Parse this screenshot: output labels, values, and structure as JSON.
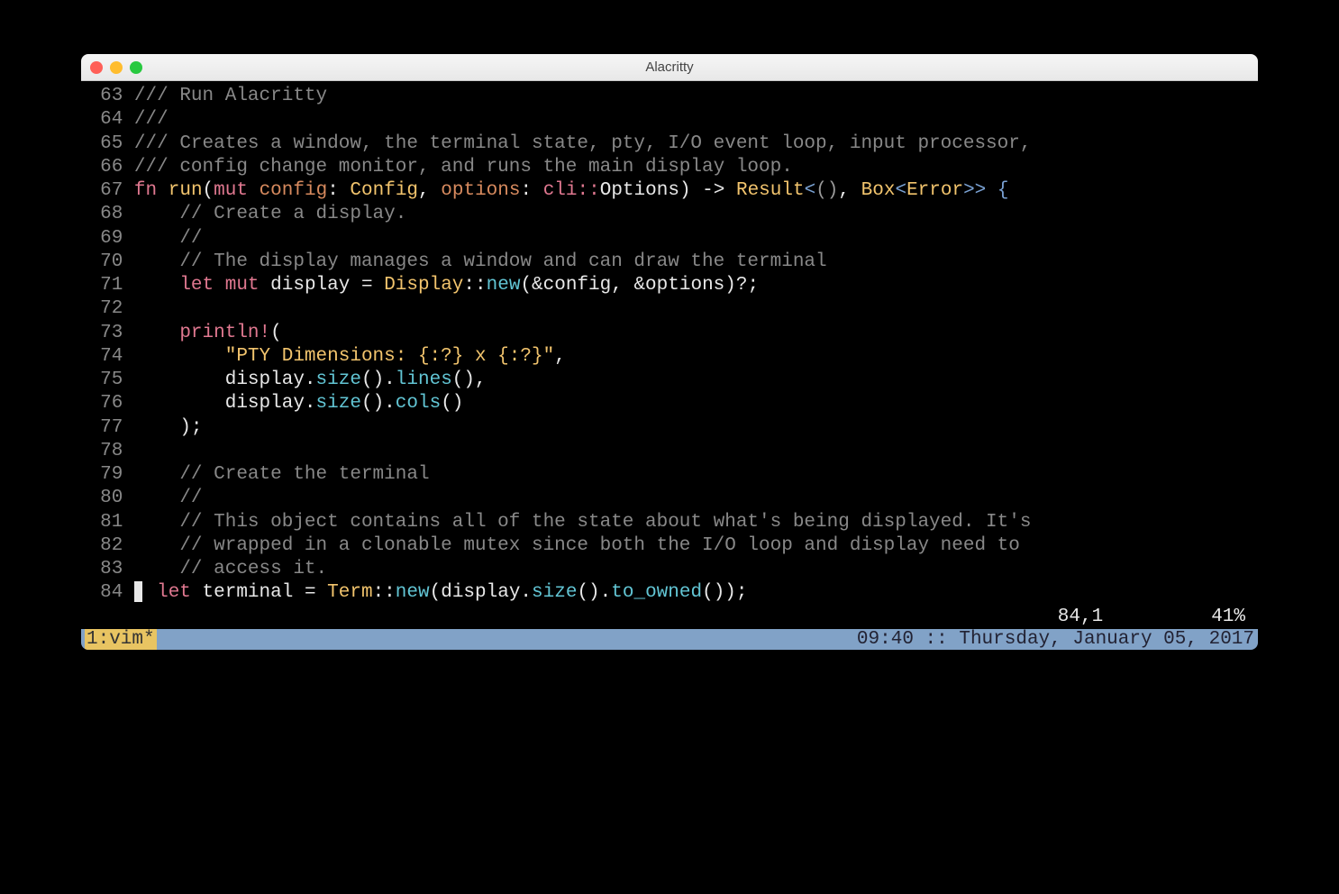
{
  "window": {
    "title": "Alacritty"
  },
  "vim_status": {
    "pos": "84,1",
    "pct": "41%"
  },
  "tmux": {
    "left": "1:vim*",
    "right": "09:40 :: Thursday, January 05, 2017"
  },
  "lines": {
    "l63_num": "63",
    "l63_a": "/// Run Alacritty",
    "l64_num": "64",
    "l64_a": "///",
    "l65_num": "65",
    "l65_a": "/// Creates a window, the terminal state, pty, I/O event loop, input processor,",
    "l66_num": "66",
    "l66_a": "/// config change monitor, and runs the main display loop.",
    "l67_num": "67",
    "l67_fn": "fn",
    "l67_run": "run",
    "l67_p1": "(",
    "l67_mut": "mut",
    "l67_conf": "config",
    "l67_colon1": ": ",
    "l67_ConfigT": "Config",
    "l67_comma1": ", ",
    "l67_opts": "options",
    "l67_colon2": ": ",
    "l67_cli": "cli::",
    "l67_OptionsT": "Options",
    "l67_p2": ") ",
    "l67_arrow": "-> ",
    "l67_Result": "Result",
    "l67_lt": "<",
    "l67_unit": "()",
    "l67_comma2": ", ",
    "l67_Box": "Box",
    "l67_lt2": "<",
    "l67_Error": "Error",
    "l67_gt": ">> {",
    "l68_num": "68",
    "l68_a": "    // Create a display.",
    "l69_num": "69",
    "l69_a": "    //",
    "l70_num": "70",
    "l70_a": "    // The display manages a window and can draw the terminal",
    "l71_num": "71",
    "l71_let": "    let",
    "l71_mut": " mut",
    "l71_disp": " display ",
    "l71_eq": "= ",
    "l71_Display": "Display",
    "l71_co": "::",
    "l71_new": "new",
    "l71_args": "(&config, &options)",
    "l71_q": "?;",
    "l72_num": "72",
    "l73_num": "73",
    "l73_print": "    println!",
    "l73_p": "(",
    "l74_num": "74",
    "l74_str": "        \"PTY Dimensions: {:?} x {:?}\"",
    "l74_c": ",",
    "l75_num": "75",
    "l75_a": "        display.",
    "l75_size": "size",
    "l75_p1": "().",
    "l75_lines": "lines",
    "l75_p2": "(),",
    "l76_num": "76",
    "l76_a": "        display.",
    "l76_size": "size",
    "l76_p1": "().",
    "l76_cols": "cols",
    "l76_p2": "()",
    "l77_num": "77",
    "l77_a": "    );",
    "l78_num": "78",
    "l79_num": "79",
    "l79_a": "    // Create the terminal",
    "l80_num": "80",
    "l80_a": "    //",
    "l81_num": "81",
    "l81_a": "    // This object contains all of the state about what's being displayed. It's",
    "l82_num": "82",
    "l82_a": "    // wrapped in a clonable mutex since both the I/O loop and display need to",
    "l83_num": "83",
    "l83_a": "    // access it.",
    "l84_num": "84",
    "l84_let": "let",
    "l84_term": " terminal ",
    "l84_eq": "= ",
    "l84_Term": "Term",
    "l84_co": "::",
    "l84_new": "new",
    "l84_p1": "(display.",
    "l84_size": "size",
    "l84_p2": "().",
    "l84_toown": "to_owned",
    "l84_p3": "());"
  }
}
